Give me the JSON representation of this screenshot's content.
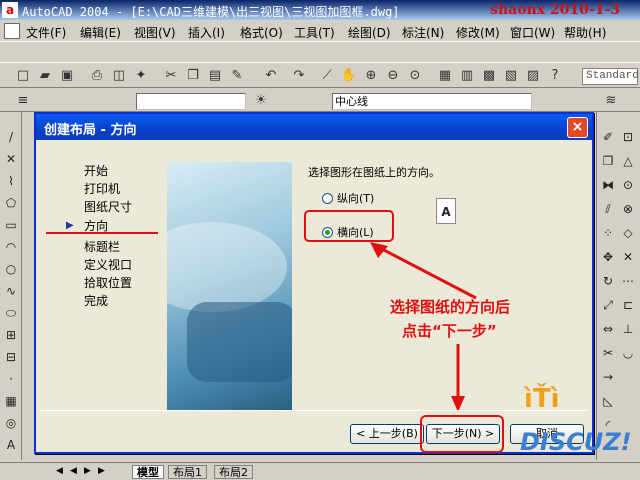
{
  "window": {
    "title": "AutoCAD 2004 - [E:\\CAD三维建模\\出三视图\\三视图加图框.dwg]",
    "watermark": "shaonx 2010-1-3"
  },
  "menu": [
    "文件(F)",
    "编辑(E)",
    "视图(V)",
    "插入(I)",
    "格式(O)",
    "工具(T)",
    "绘图(D)",
    "标注(N)",
    "修改(M)",
    "窗口(W)",
    "帮助(H)"
  ],
  "toolbar": {
    "text_style": "Standard",
    "layer_combo": "中心线"
  },
  "dialog": {
    "title": "创建布局 - 方向",
    "close_label": "×",
    "steps": [
      "开始",
      "打印机",
      "图纸尺寸",
      "方向",
      "标题栏",
      "定义视口",
      "拾取位置",
      "完成"
    ],
    "current_step_index": 3,
    "prompt": "选择图形在图纸上的方向。",
    "radio_portrait": "纵向(T)",
    "radio_landscape": "横向(L)",
    "selected_orientation": "landscape",
    "page_icon_letter": "A",
    "back_button": "< 上一步(B)",
    "next_button": "下一步(N) >",
    "cancel_button": "取消"
  },
  "annotation": {
    "line1": "选择图纸的方向后",
    "line2": "点击“下一步”"
  },
  "tabs": [
    "模型",
    "布局1",
    "布局2"
  ],
  "active_tab_index": 0,
  "logo_text": "DISCUZ!",
  "colors": {
    "title_gradient_start": "#0a246a",
    "dialog_title": "#0842c8",
    "annotation_red": "#e01010",
    "watermark_red": "#d01010"
  }
}
